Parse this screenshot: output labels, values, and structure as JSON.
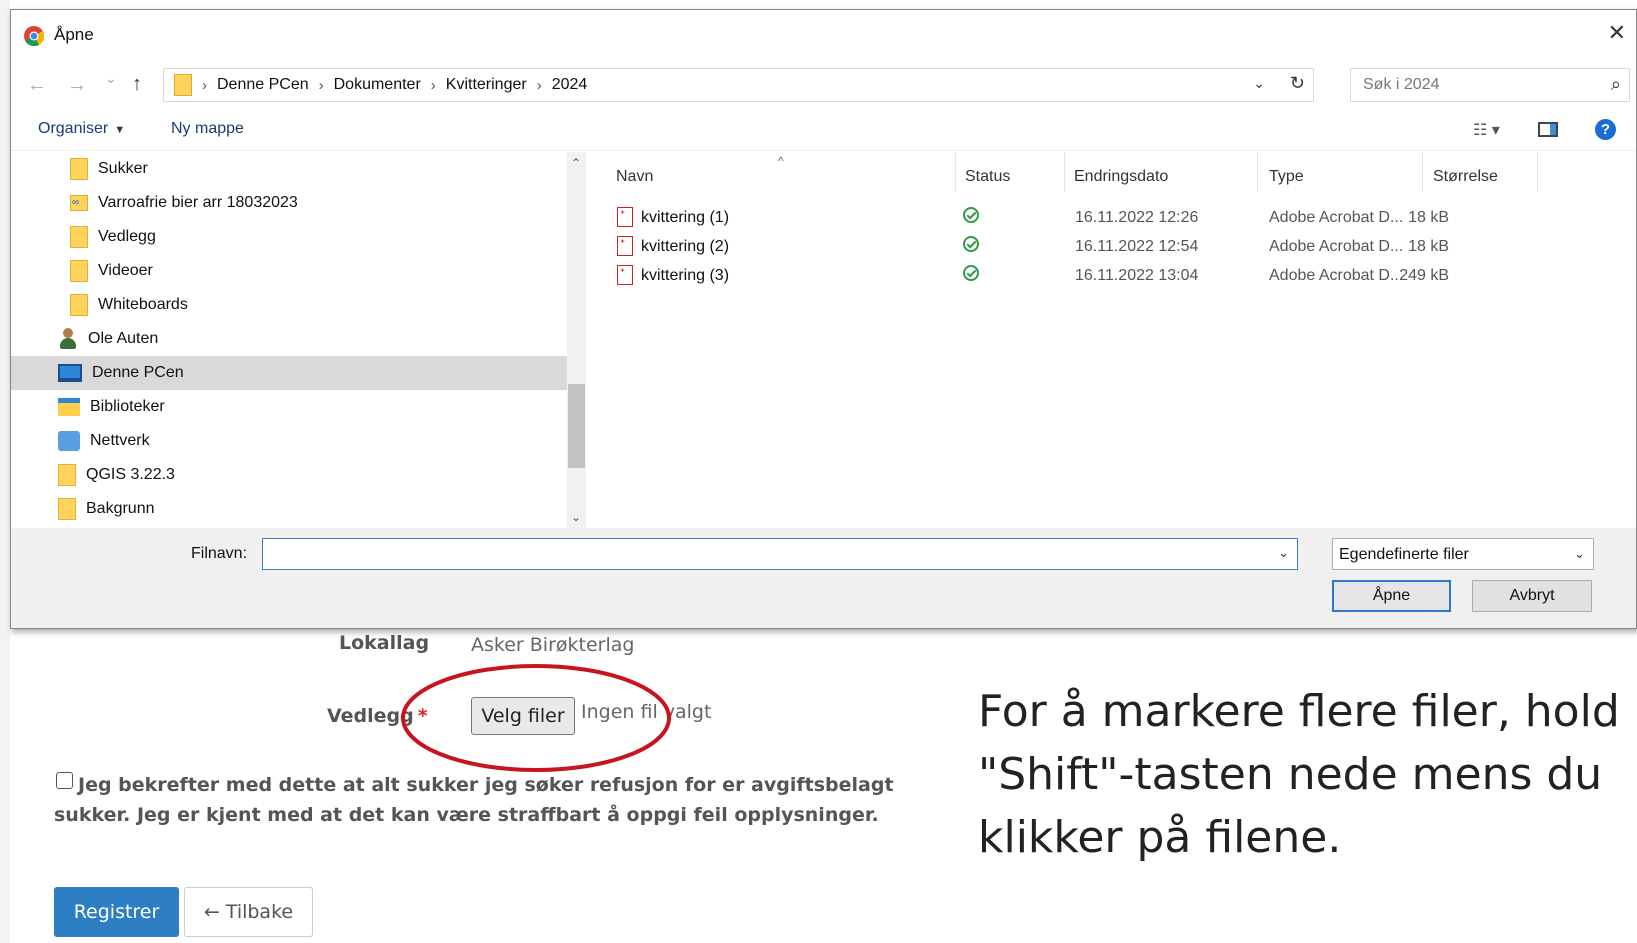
{
  "dialog": {
    "title": "Åpne",
    "close_glyph": "✕",
    "nav": {
      "back_glyph": "←",
      "forward_glyph": "→",
      "recent_glyph": "⌄",
      "up_glyph": "↑",
      "breadcrumbs": [
        "Denne PCen",
        "Dokumenter",
        "Kvitteringer",
        "2024"
      ],
      "separator": "›",
      "dropdown_glyph": "⌄",
      "refresh_glyph": "↻",
      "search_placeholder": "Søk i 2024",
      "search_glyph": "⌕"
    },
    "toolbar": {
      "organize": "Organiser",
      "organize_caret": "▼",
      "new_folder": "Ny mappe",
      "view_glyph": "☷ ▾",
      "help_glyph": "?"
    },
    "sidebar": {
      "scroll_up": "⌃",
      "scroll_down": "⌄",
      "items": [
        {
          "label": "Sukker",
          "icon": "folder-icon"
        },
        {
          "label": "Varroafrie bier arr 18032023",
          "icon": "linked-folder-icon"
        },
        {
          "label": "Vedlegg",
          "icon": "folder-icon"
        },
        {
          "label": "Videoer",
          "icon": "folder-icon"
        },
        {
          "label": "Whiteboards",
          "icon": "folder-icon"
        },
        {
          "label": "Ole Auten",
          "icon": "user-icon"
        },
        {
          "label": "Denne PCen",
          "icon": "computer-icon",
          "selected": true
        },
        {
          "label": "Biblioteker",
          "icon": "library-icon"
        },
        {
          "label": "Nettverk",
          "icon": "network-icon"
        },
        {
          "label": "QGIS 3.22.3",
          "icon": "folder-icon"
        },
        {
          "label": "Bakgrunn",
          "icon": "folder-icon"
        }
      ]
    },
    "filelist": {
      "sort_glyph": "^",
      "columns": {
        "name": "Navn",
        "status": "Status",
        "date": "Endringsdato",
        "type": "Type",
        "size": "Størrelse"
      },
      "files": [
        {
          "name": "kvittering (1)",
          "date": "16.11.2022 12:26",
          "type": "Adobe Acrobat D...",
          "size": "18 kB"
        },
        {
          "name": "kvittering (2)",
          "date": "16.11.2022 12:54",
          "type": "Adobe Acrobat D...",
          "size": "18 kB"
        },
        {
          "name": "kvittering (3)",
          "date": "16.11.2022 13:04",
          "type": "Adobe Acrobat D...",
          "size": "249 kB"
        }
      ]
    },
    "bottom": {
      "filename_label": "Filnavn:",
      "filename_value": "",
      "dropdown_glyph": "⌄",
      "filetype": "Egendefinerte filer",
      "open_button": "Åpne",
      "cancel_button": "Avbryt"
    }
  },
  "form": {
    "local_label": "Lokallag",
    "local_value": "Asker Birøkterlag",
    "attachment_label": "Vedlegg",
    "required_mark": "*",
    "choose_files": "Velg filer",
    "no_file": "Ingen fil valgt",
    "confirm_text": "Jeg bekrefter med dette at alt sukker jeg søker refusjon for er avgiftsbelagt sukker. Jeg er kjent med at det kan være straffbart å oppgi feil opplysninger.",
    "register_button": "Registrer",
    "back_arrow": "←",
    "back_button": "Tilbake",
    "highlight_color": "#c8141e"
  },
  "instruction": "For å markere flere filer, hold \"Shift\"-tasten nede mens du klikker på filene."
}
